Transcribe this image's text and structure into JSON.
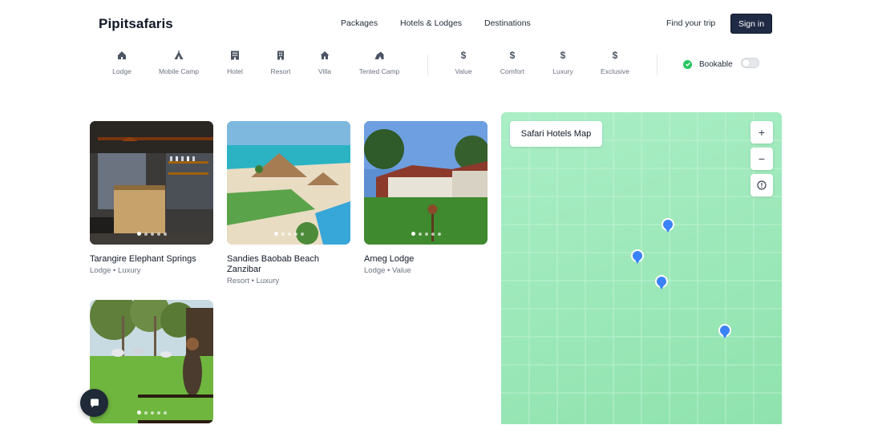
{
  "brand": {
    "name": "Pipitsafaris"
  },
  "nav": {
    "links": [
      "Packages",
      "Hotels & Lodges",
      "Destinations"
    ],
    "find_trip": "Find your trip",
    "sign_in": "Sign in"
  },
  "filters": {
    "types": [
      {
        "label": "Lodge",
        "icon": "lodge-icon"
      },
      {
        "label": "Mobile Camp",
        "icon": "mobile-camp-icon"
      },
      {
        "label": "Hotel",
        "icon": "hotel-icon"
      },
      {
        "label": "Resort",
        "icon": "resort-icon"
      },
      {
        "label": "Villa",
        "icon": "villa-icon"
      },
      {
        "label": "Tented Camp",
        "icon": "tented-camp-icon"
      }
    ],
    "prices": [
      {
        "label": "Value",
        "symbol": "$"
      },
      {
        "label": "Comfort",
        "symbol": "$"
      },
      {
        "label": "Luxury",
        "symbol": "$"
      },
      {
        "label": "Exclusive",
        "symbol": "$"
      }
    ],
    "bookable": {
      "label": "Bookable",
      "checked_color": "#22c55e",
      "toggle_on": false
    }
  },
  "listings": [
    {
      "name": "Tarangire Elephant Springs",
      "category": "Lodge",
      "tier": "Luxury",
      "photo_slides": 5,
      "active_slide": 1
    },
    {
      "name": "Sandies Baobab Beach Zanzibar",
      "category": "Resort",
      "tier": "Luxury",
      "photo_slides": 5,
      "active_slide": 1
    },
    {
      "name": "Ameg Lodge",
      "category": "Lodge",
      "tier": "Value",
      "photo_slides": 5,
      "active_slide": 1
    },
    {
      "name": "",
      "category": "",
      "tier": "",
      "photo_slides": 5,
      "active_slide": 1
    }
  ],
  "map": {
    "title": "Safari Hotels Map",
    "zoom_in": "+",
    "zoom_out": "−",
    "info": "!",
    "pin_color": "#3b82f6",
    "pin_count": 4
  },
  "colors": {
    "accent_dark": "#1f2a44",
    "map_green": "#9ae8b8",
    "pin": "#3b82f6"
  }
}
